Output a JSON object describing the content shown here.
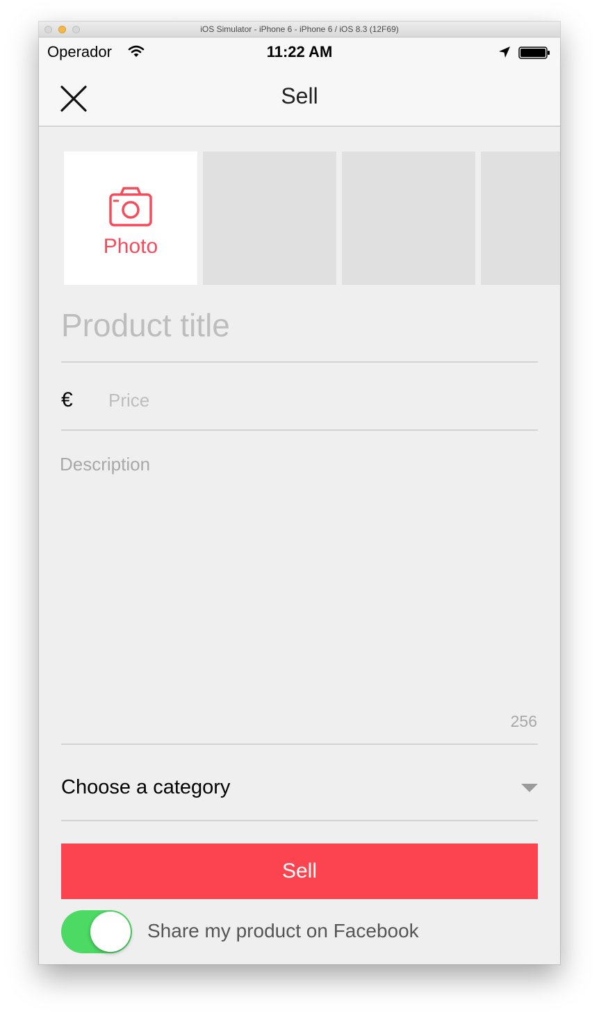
{
  "window": {
    "title": "iOS Simulator - iPhone 6 - iPhone 6 / iOS 8.3 (12F69)"
  },
  "status_bar": {
    "carrier": "Operador",
    "time": "11:22 AM",
    "icons": [
      "wifi-icon",
      "location-arrow-icon",
      "battery-icon"
    ]
  },
  "nav": {
    "title": "Sell",
    "close_icon": "close-icon"
  },
  "photos": {
    "add_label": "Photo",
    "add_icon": "camera-icon",
    "empty_slots": 3
  },
  "form": {
    "title_placeholder": "Product title",
    "currency_symbol": "€",
    "price_placeholder": "Price",
    "description_placeholder": "Description",
    "description_counter": "256",
    "category_label": "Choose a category",
    "category_icon": "dropdown-arrow-icon"
  },
  "actions": {
    "sell_label": "Sell",
    "share_label": "Share my product on Facebook",
    "share_enabled": true
  },
  "colors": {
    "accent": "#fc4451",
    "toggle_on": "#4cd964",
    "placeholder": "#bdbdbd",
    "background": "#efefef"
  }
}
